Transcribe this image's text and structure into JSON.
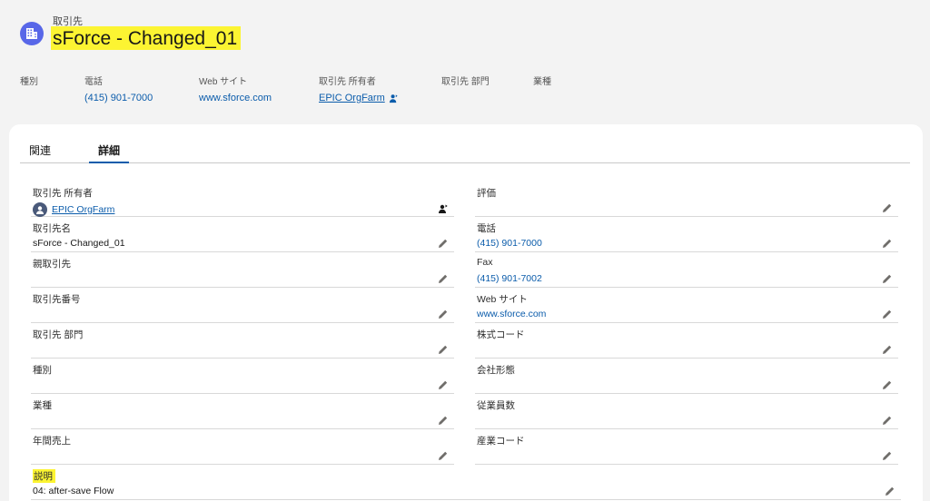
{
  "header": {
    "object_type": "取引先",
    "record_name": "sForce - Changed_01",
    "icon": "account-building-icon"
  },
  "highlights": [
    {
      "label": "種別",
      "value": ""
    },
    {
      "label": "電話",
      "value": "(415) 901-7000"
    },
    {
      "label": "Web サイト",
      "value": "www.sforce.com"
    },
    {
      "label": "取引先 所有者",
      "value": "EPIC OrgFarm"
    },
    {
      "label": "取引先 部門",
      "value": ""
    },
    {
      "label": "業種",
      "value": ""
    }
  ],
  "tabs": [
    {
      "label": "関連",
      "active": false
    },
    {
      "label": "詳細",
      "active": true
    }
  ],
  "details": {
    "left": [
      {
        "label": "取引先 所有者",
        "value": "EPIC OrgFarm",
        "type": "owner"
      },
      {
        "label": "取引先名",
        "value": "sForce - Changed_01",
        "type": "text"
      },
      {
        "label": "親取引先",
        "value": "",
        "type": "text"
      },
      {
        "label": "取引先番号",
        "value": "",
        "type": "text"
      },
      {
        "label": "取引先 部門",
        "value": "",
        "type": "text"
      },
      {
        "label": "種別",
        "value": "",
        "type": "text"
      },
      {
        "label": "業種",
        "value": "",
        "type": "text"
      },
      {
        "label": "年間売上",
        "value": "",
        "type": "text"
      }
    ],
    "right": [
      {
        "label": "評価",
        "value": "",
        "type": "text"
      },
      {
        "label": "電話",
        "value": "(415) 901-7000",
        "type": "link"
      },
      {
        "label": "Fax",
        "value": "(415) 901-7002",
        "type": "link"
      },
      {
        "label": "Web サイト",
        "value": "www.sforce.com",
        "type": "link"
      },
      {
        "label": "株式コード",
        "value": "",
        "type": "text"
      },
      {
        "label": "会社形態",
        "value": "",
        "type": "text"
      },
      {
        "label": "従業員数",
        "value": "",
        "type": "text"
      },
      {
        "label": "産業コード",
        "value": "",
        "type": "text"
      }
    ],
    "description": {
      "label": "説明",
      "value": "04: after-save Flow"
    }
  },
  "colors": {
    "accent": "#0b5cab",
    "highlight": "#fcf432",
    "icon_bg": "#5867e8"
  }
}
